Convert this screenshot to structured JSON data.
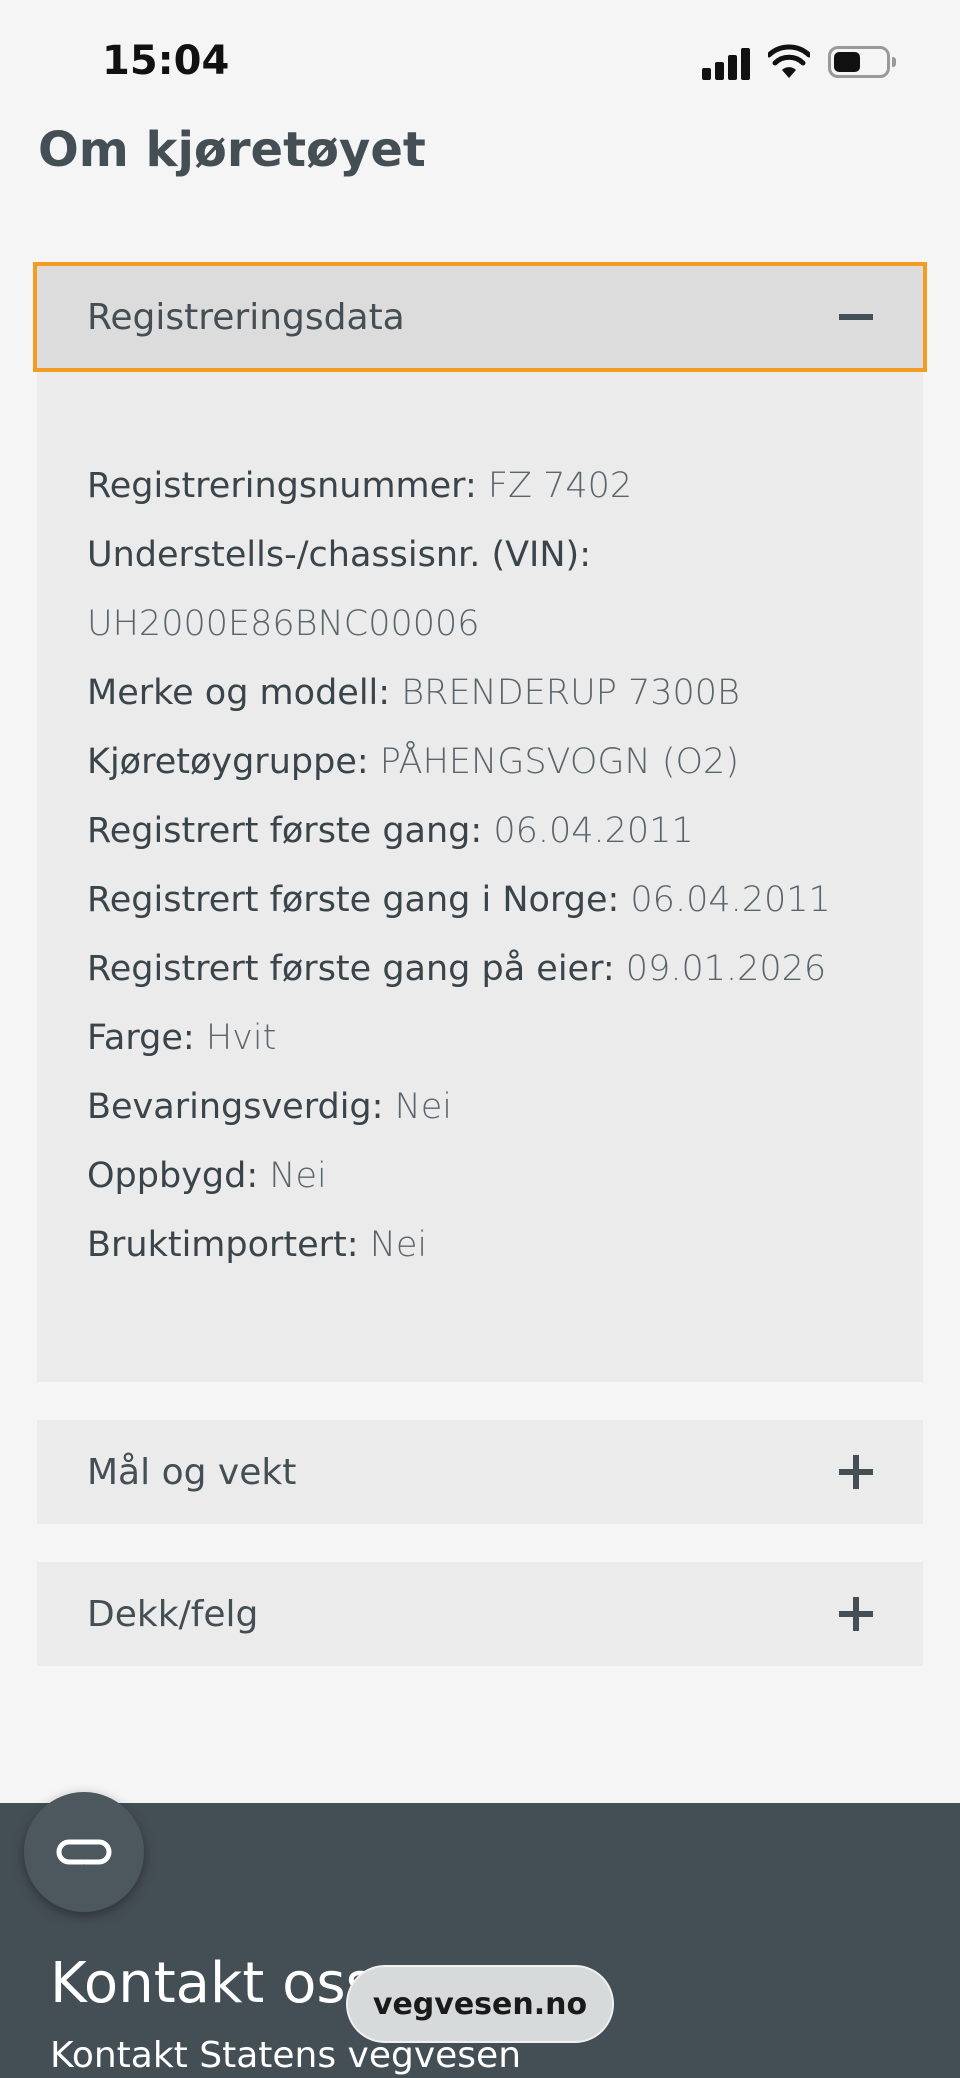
{
  "status_bar": {
    "time": "15:04"
  },
  "page": {
    "title": "Om kjøretøyet"
  },
  "accordion": {
    "open_section": {
      "title": "Registreringsdata",
      "fields": [
        {
          "label": "Registreringsnummer:",
          "value": "FZ 7402"
        },
        {
          "label": "Understells-/chassisnr. (VIN):",
          "value": "UH2000E86BNC00006"
        },
        {
          "label": "Merke og modell:",
          "value": "BRENDERUP 7300B"
        },
        {
          "label": "Kjøretøygruppe:",
          "value": "PÅHENGSVOGN (O2)"
        },
        {
          "label": "Registrert første gang:",
          "value": "06.04.2011"
        },
        {
          "label": "Registrert første gang i Norge:",
          "value": "06.04.2011"
        },
        {
          "label": "Registrert første gang på eier:",
          "value": "09.01.2026"
        },
        {
          "label": "Farge:",
          "value": "Hvit"
        },
        {
          "label": "Bevaringsverdig:",
          "value": "Nei"
        },
        {
          "label": "Oppbygd:",
          "value": "Nei"
        },
        {
          "label": "Bruktimportert:",
          "value": "Nei"
        }
      ]
    },
    "closed_sections": [
      {
        "title": "Mål og vekt"
      },
      {
        "title": "Dekk/felg"
      }
    ]
  },
  "footer": {
    "title": "Kontakt oss",
    "subtitle": "Kontakt Statens vegvesen"
  },
  "browser": {
    "url": "vegvesen.no"
  },
  "icons": {
    "collapse": "minus-icon",
    "expand": "plus-icon",
    "fab": "loop-icon"
  },
  "colors": {
    "accent_focus": "#f39c22",
    "footer_bg": "#444f55",
    "text": "#444f55"
  }
}
